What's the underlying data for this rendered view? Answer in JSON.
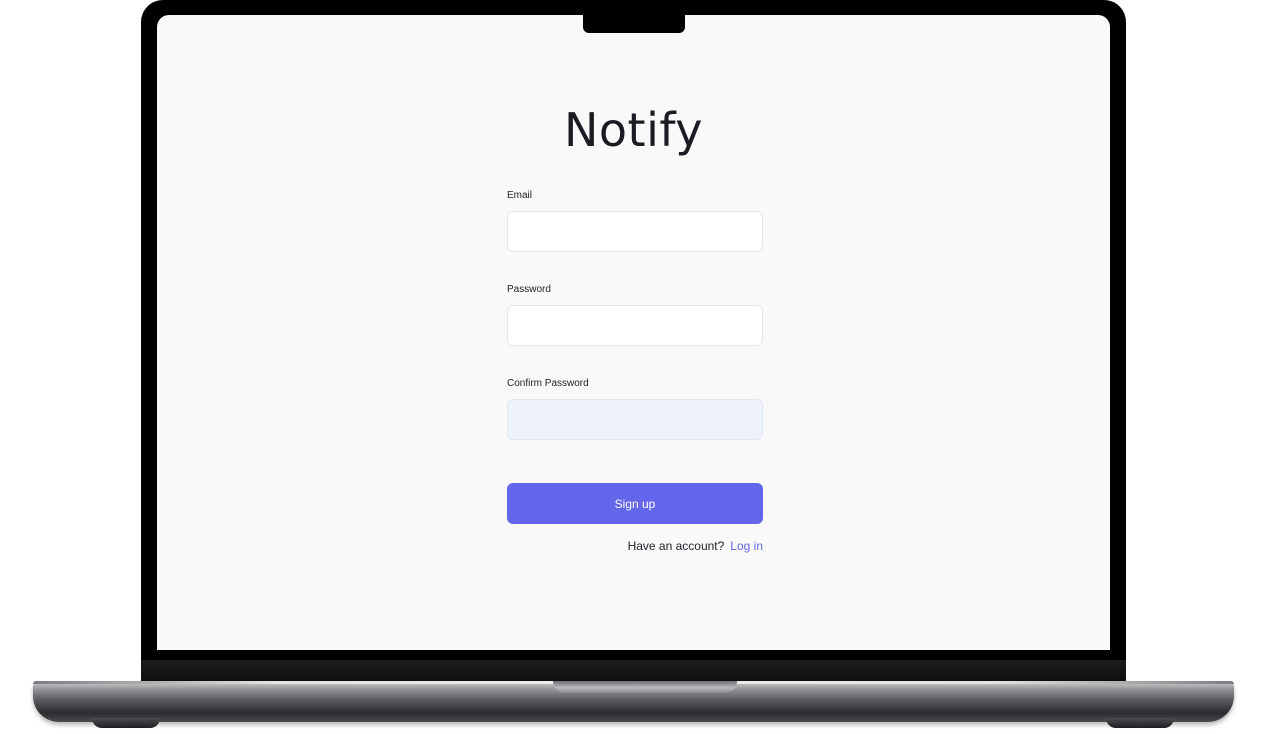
{
  "app": {
    "title": "Notify"
  },
  "form": {
    "email_label": "Email",
    "email_value": "",
    "password_label": "Password",
    "password_value": "",
    "confirm_label": "Confirm Password",
    "confirm_value": "",
    "submit_label": "Sign up"
  },
  "footer": {
    "prompt": "Have an account?",
    "login_link": "Log in"
  },
  "colors": {
    "accent": "#6366ea",
    "screen_bg": "#f9f9f9",
    "text": "#1b1c22"
  }
}
